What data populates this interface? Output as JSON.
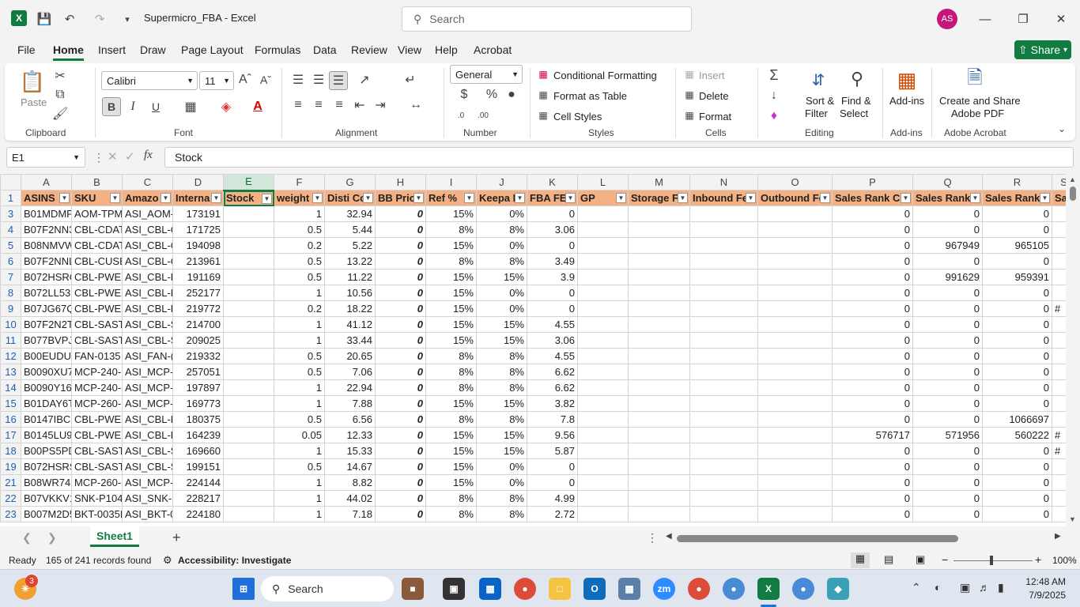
{
  "titlebar": {
    "title": "Supermicro_FBA  -  Excel",
    "search_placeholder": "Search",
    "user_initials": "AS",
    "app_logo": "X"
  },
  "menu": [
    "File",
    "Home",
    "Insert",
    "Draw",
    "Page Layout",
    "Formulas",
    "Data",
    "Review",
    "View",
    "Help",
    "Acrobat"
  ],
  "share_label": "Share",
  "ribbon": {
    "clipboard": {
      "paste": "Paste",
      "label": "Clipboard"
    },
    "font": {
      "name": "Calibri",
      "size": "11",
      "label": "Font"
    },
    "alignment": {
      "label": "Alignment"
    },
    "number": {
      "format": "General",
      "label": "Number"
    },
    "styles": {
      "conditional": "Conditional Formatting",
      "format_table": "Format as Table",
      "cell_styles": "Cell Styles",
      "label": "Styles"
    },
    "cells": {
      "insert": "Insert",
      "delete": "Delete",
      "format": "Format",
      "label": "Cells"
    },
    "editing": {
      "sort": "Sort &",
      "filter": "Filter",
      "find": "Find &",
      "select": "Select",
      "label": "Editing"
    },
    "addins": {
      "button": "Add-ins",
      "label": "Add-ins"
    },
    "acrobat": {
      "line1": "Create and Share",
      "line2": "Adobe PDF",
      "label": "Adobe Acrobat"
    }
  },
  "formula_bar": {
    "name_box": "E1",
    "content": "Stock"
  },
  "grid": {
    "columns": [
      "A",
      "B",
      "C",
      "D",
      "E",
      "F",
      "G",
      "H",
      "I",
      "J",
      "K",
      "L",
      "M",
      "N",
      "O",
      "P",
      "Q",
      "R",
      "S"
    ],
    "headers": [
      "ASINS",
      "SKU",
      "Amazo",
      "Interna",
      "Stock",
      "weight",
      "Disti Co",
      "BB Pric",
      "Ref %",
      "Keepa I",
      "FBA FEI",
      "GP",
      "Storage F",
      "Inbound Fe",
      "Outbound Fe",
      "Sales Rank Cu",
      "Sales Rank",
      "Sales Rank",
      "Sa"
    ],
    "rows": [
      {
        "n": "3",
        "c": [
          "B01MDMP",
          "AOM-TPM",
          "ASI_AOM-",
          "173191",
          "",
          "1",
          "32.94",
          "0",
          "15%",
          "0%",
          "0",
          "",
          "",
          "",
          "",
          "0",
          "0",
          "0",
          ""
        ]
      },
      {
        "n": "4",
        "c": [
          "B07F2NN3",
          "CBL-CDAT",
          "ASI_CBL-C",
          "171725",
          "",
          "0.5",
          "5.44",
          "0",
          "8%",
          "8%",
          "3.06",
          "",
          "",
          "",
          "",
          "0",
          "0",
          "0",
          ""
        ]
      },
      {
        "n": "5",
        "c": [
          "B08NMVW",
          "CBL-CDAT",
          "ASI_CBL-C",
          "194098",
          "",
          "0.2",
          "5.22",
          "0",
          "15%",
          "0%",
          "0",
          "",
          "",
          "",
          "",
          "0",
          "967949",
          "965105",
          ""
        ]
      },
      {
        "n": "6",
        "c": [
          "B07F2NNL",
          "CBL-CUSB",
          "ASI_CBL-C",
          "213961",
          "",
          "0.5",
          "13.22",
          "0",
          "8%",
          "8%",
          "3.49",
          "",
          "",
          "",
          "",
          "0",
          "0",
          "0",
          ""
        ]
      },
      {
        "n": "7",
        "c": [
          "B072HSRO",
          "CBL-PWEX",
          "ASI_CBL-P",
          "191169",
          "",
          "0.5",
          "11.22",
          "0",
          "15%",
          "15%",
          "3.9",
          "",
          "",
          "",
          "",
          "0",
          "991629",
          "959391",
          ""
        ]
      },
      {
        "n": "8",
        "c": [
          "B072LL53R",
          "CBL-PWEX",
          "ASI_CBL-P",
          "252177",
          "",
          "1",
          "10.56",
          "0",
          "15%",
          "0%",
          "0",
          "",
          "",
          "",
          "",
          "0",
          "0",
          "0",
          ""
        ]
      },
      {
        "n": "9",
        "c": [
          "B07JG67Q",
          "CBL-PWEX",
          "ASI_CBL-P",
          "219772",
          "",
          "0.2",
          "18.22",
          "0",
          "15%",
          "0%",
          "0",
          "",
          "",
          "",
          "",
          "0",
          "0",
          "0",
          "#"
        ]
      },
      {
        "n": "10",
        "c": [
          "B07F2N2T",
          "CBL-SAST-",
          "ASI_CBL-S",
          "214700",
          "",
          "1",
          "41.12",
          "0",
          "15%",
          "15%",
          "4.55",
          "",
          "",
          "",
          "",
          "0",
          "0",
          "0",
          ""
        ]
      },
      {
        "n": "11",
        "c": [
          "B077BVPJ",
          "CBL-SAST-",
          "ASI_CBL-S",
          "209025",
          "",
          "1",
          "33.44",
          "0",
          "15%",
          "15%",
          "3.06",
          "",
          "",
          "",
          "",
          "0",
          "0",
          "0",
          ""
        ]
      },
      {
        "n": "12",
        "c": [
          "B00EUDU",
          "FAN-0135",
          "ASI_FAN-(",
          "219332",
          "",
          "0.5",
          "20.65",
          "0",
          "8%",
          "8%",
          "4.55",
          "",
          "",
          "",
          "",
          "0",
          "0",
          "0",
          ""
        ]
      },
      {
        "n": "13",
        "c": [
          "B0090XU7",
          "MCP-240-",
          "ASI_MCP-",
          "257051",
          "",
          "0.5",
          "7.06",
          "0",
          "8%",
          "8%",
          "6.62",
          "",
          "",
          "",
          "",
          "0",
          "0",
          "0",
          ""
        ]
      },
      {
        "n": "14",
        "c": [
          "B0090Y16A",
          "MCP-240-(",
          "ASI_MCP-",
          "197897",
          "",
          "1",
          "22.94",
          "0",
          "8%",
          "8%",
          "6.62",
          "",
          "",
          "",
          "",
          "0",
          "0",
          "0",
          ""
        ]
      },
      {
        "n": "15",
        "c": [
          "B01DAY6T",
          "MCP-260-",
          "ASI_MCP-",
          "169773",
          "",
          "1",
          "7.88",
          "0",
          "15%",
          "15%",
          "3.82",
          "",
          "",
          "",
          "",
          "0",
          "0",
          "0",
          ""
        ]
      },
      {
        "n": "16",
        "c": [
          "B0147IBC1",
          "CBL-PWEX",
          "ASI_CBL-P",
          "180375",
          "",
          "0.5",
          "6.56",
          "0",
          "8%",
          "8%",
          "7.8",
          "",
          "",
          "",
          "",
          "0",
          "0",
          "1066697",
          ""
        ]
      },
      {
        "n": "17",
        "c": [
          "B0145LU9",
          "CBL-PWEX",
          "ASI_CBL-P",
          "164239",
          "",
          "0.05",
          "12.33",
          "0",
          "15%",
          "15%",
          "9.56",
          "",
          "",
          "",
          "",
          "576717",
          "571956",
          "560222",
          "#"
        ]
      },
      {
        "n": "18",
        "c": [
          "B00PS5PD",
          "CBL-SAST-",
          "ASI_CBL-S",
          "169660",
          "",
          "1",
          "15.33",
          "0",
          "15%",
          "15%",
          "5.87",
          "",
          "",
          "",
          "",
          "0",
          "0",
          "0",
          "#"
        ]
      },
      {
        "n": "19",
        "c": [
          "B072HSRS",
          "CBL-SAST-",
          "ASI_CBL-S",
          "199151",
          "",
          "0.5",
          "14.67",
          "0",
          "15%",
          "0%",
          "0",
          "",
          "",
          "",
          "",
          "0",
          "0",
          "0",
          ""
        ]
      },
      {
        "n": "21",
        "c": [
          "B08WR74N",
          "MCP-260-(",
          "ASI_MCP-",
          "224144",
          "",
          "1",
          "8.82",
          "0",
          "15%",
          "0%",
          "0",
          "",
          "",
          "",
          "",
          "0",
          "0",
          "0",
          ""
        ]
      },
      {
        "n": "22",
        "c": [
          "B07VKKV1",
          "SNK-P104:",
          "ASI_SNK-F",
          "228217",
          "",
          "1",
          "44.02",
          "0",
          "8%",
          "8%",
          "4.99",
          "",
          "",
          "",
          "",
          "0",
          "0",
          "0",
          ""
        ]
      },
      {
        "n": "23",
        "c": [
          "B007M2D5",
          "BKT-0035L",
          "ASI_BKT-0",
          "224180",
          "",
          "1",
          "7.18",
          "0",
          "8%",
          "8%",
          "2.72",
          "",
          "",
          "",
          "",
          "0",
          "0",
          "0",
          ""
        ]
      }
    ]
  },
  "sheet": {
    "tab": "Sheet1",
    "add": "+"
  },
  "status": {
    "ready": "Ready",
    "records": "165 of 241 records found",
    "accessibility": "Accessibility: Investigate",
    "zoom": "100%"
  },
  "taskbar": {
    "search": "Search",
    "time": "12:48 AM",
    "date": "7/9/2025",
    "badge": "3"
  }
}
